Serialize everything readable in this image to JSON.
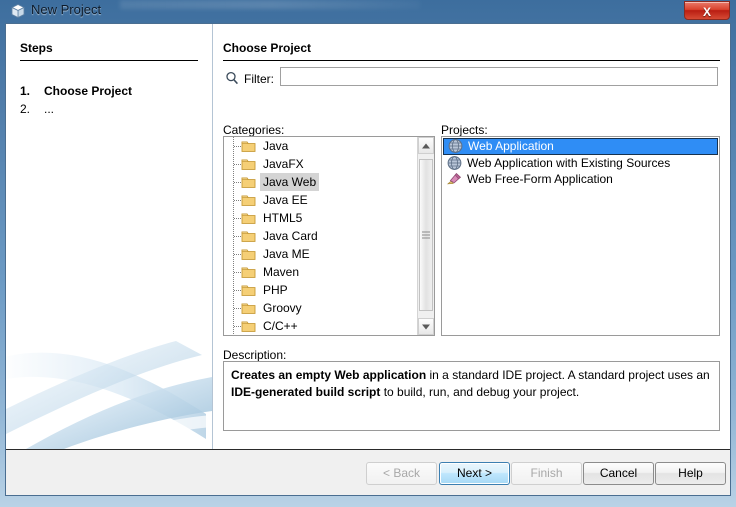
{
  "window": {
    "title": "New Project",
    "title_icon": "cube-icon",
    "close_label": "X"
  },
  "steps": {
    "heading": "Steps",
    "items": [
      {
        "number": "1.",
        "label": "Choose Project",
        "current": true
      },
      {
        "number": "2.",
        "label": "...",
        "current": false
      }
    ]
  },
  "content": {
    "heading": "Choose Project",
    "filter": {
      "icon": "search-icon",
      "label": "Filter:",
      "value": "",
      "placeholder": ""
    },
    "categories": {
      "label": "Categories:",
      "items": [
        {
          "label": "Java",
          "selected": false
        },
        {
          "label": "JavaFX",
          "selected": false
        },
        {
          "label": "Java Web",
          "selected": true
        },
        {
          "label": "Java EE",
          "selected": false
        },
        {
          "label": "HTML5",
          "selected": false
        },
        {
          "label": "Java Card",
          "selected": false
        },
        {
          "label": "Java ME",
          "selected": false
        },
        {
          "label": "Maven",
          "selected": false
        },
        {
          "label": "PHP",
          "selected": false
        },
        {
          "label": "Groovy",
          "selected": false
        },
        {
          "label": "C/C++",
          "selected": false
        }
      ],
      "scrollbar": {
        "up_arrow": "scroll-up-arrow-icon",
        "down_arrow": "scroll-down-arrow-icon"
      }
    },
    "projects": {
      "label": "Projects:",
      "items": [
        {
          "label": "Web Application",
          "icon": "globe-icon",
          "selected": true
        },
        {
          "label": "Web Application with Existing Sources",
          "icon": "globe-icon",
          "selected": false
        },
        {
          "label": "Web Free-Form Application",
          "icon": "freeform-icon",
          "selected": false
        }
      ]
    },
    "description": {
      "label": "Description:",
      "bold1": "Creates an empty Web application",
      "text1": " in a standard IDE project. A standard project uses an ",
      "bold2": "IDE-generated build script",
      "text2": " to build, run, and debug your project."
    }
  },
  "buttons": {
    "back": "< Back",
    "next": "Next >",
    "finish": "Finish",
    "cancel": "Cancel",
    "help": "Help"
  },
  "colors": {
    "selection_blue": "#2f8df5",
    "close_red": "#b91d12",
    "titlebar_blue": "#4e7ba8",
    "folder_yellow": "#f0c060"
  }
}
